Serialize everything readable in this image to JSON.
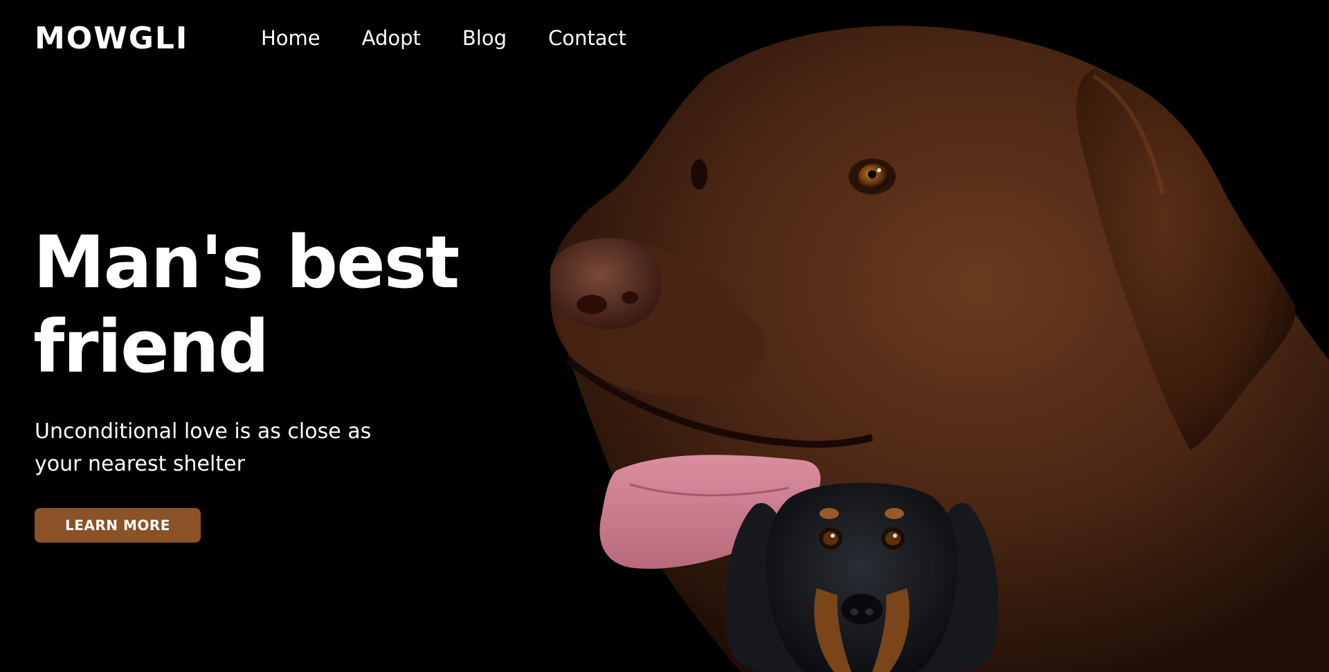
{
  "header": {
    "logo": "MOWGLI",
    "nav": [
      {
        "label": "Home"
      },
      {
        "label": "Adopt"
      },
      {
        "label": "Blog"
      },
      {
        "label": "Contact"
      }
    ]
  },
  "hero": {
    "title_line1": "Man's best",
    "title_line2": "friend",
    "subtitle_line1": "Unconditional love is as close as",
    "subtitle_line2": "your nearest shelter",
    "button_label": "LEARN MORE"
  },
  "images": {
    "large_dog": "chocolate-labrador",
    "small_dog": "black-and-tan-dachshund"
  },
  "colors": {
    "background": "#000000",
    "text": "#ffffff",
    "button": "#8a5226"
  }
}
